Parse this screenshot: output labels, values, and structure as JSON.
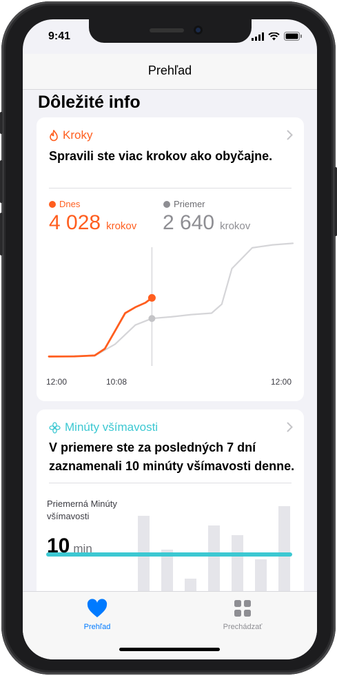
{
  "status": {
    "time": "9:41"
  },
  "nav": {
    "title": "Prehľad"
  },
  "section": {
    "title": "Dôležité info"
  },
  "steps_card": {
    "title": "Kroky",
    "description": "Spravili ste viac krokov ako obyčajne.",
    "today_label": "Dnes",
    "today_value": "4 028",
    "today_unit": "krokov",
    "avg_label": "Priemer",
    "avg_value": "2 640",
    "avg_unit": "krokov",
    "ticks": [
      "12:00",
      "10:08",
      "12:00"
    ],
    "colors": {
      "accent": "#ff5e1f",
      "avg": "#8e8e93"
    }
  },
  "mind_card": {
    "title": "Minúty všímavosti",
    "description_line1": "V priemere ste za posledných 7 dní",
    "description_line2": "zaznamenali 10 minúty všímavosti denne.",
    "avg_label_line1": "Priemerná Minúty",
    "avg_label_line2": "všímavosti",
    "avg_value": "10",
    "avg_unit": "min",
    "colors": {
      "accent": "#3cc8d2"
    }
  },
  "tabs": [
    {
      "label": "Prehľad",
      "icon": "heart-icon",
      "active": true
    },
    {
      "label": "Prechádzať",
      "icon": "grid-icon",
      "active": false
    }
  ],
  "chart_data": [
    {
      "type": "line",
      "x_range": [
        "00:00",
        "24:00"
      ],
      "series": [
        {
          "name": "Dnes",
          "x_hours": [
            0,
            2.5,
            4.5,
            5.5,
            6.5,
            7.5,
            8.5,
            9.5,
            10.13
          ],
          "y": [
            80,
            90,
            150,
            600,
            1800,
            3000,
            3400,
            3700,
            4028
          ]
        },
        {
          "name": "Priemer",
          "x_hours": [
            0,
            4.5,
            6.5,
            8.5,
            10.13,
            12,
            14,
            16,
            17,
            18,
            20,
            22,
            24
          ],
          "y": [
            70,
            130,
            900,
            2200,
            2640,
            2750,
            2900,
            3000,
            3600,
            6000,
            7400,
            7600,
            7700
          ]
        }
      ],
      "current_time": "10:08",
      "xlabels": [
        "12:00",
        "10:08",
        "12:00"
      ]
    },
    {
      "type": "bar",
      "values": [
        18,
        11,
        5,
        16,
        14,
        9,
        20
      ],
      "average": 10,
      "unit": "min"
    }
  ]
}
